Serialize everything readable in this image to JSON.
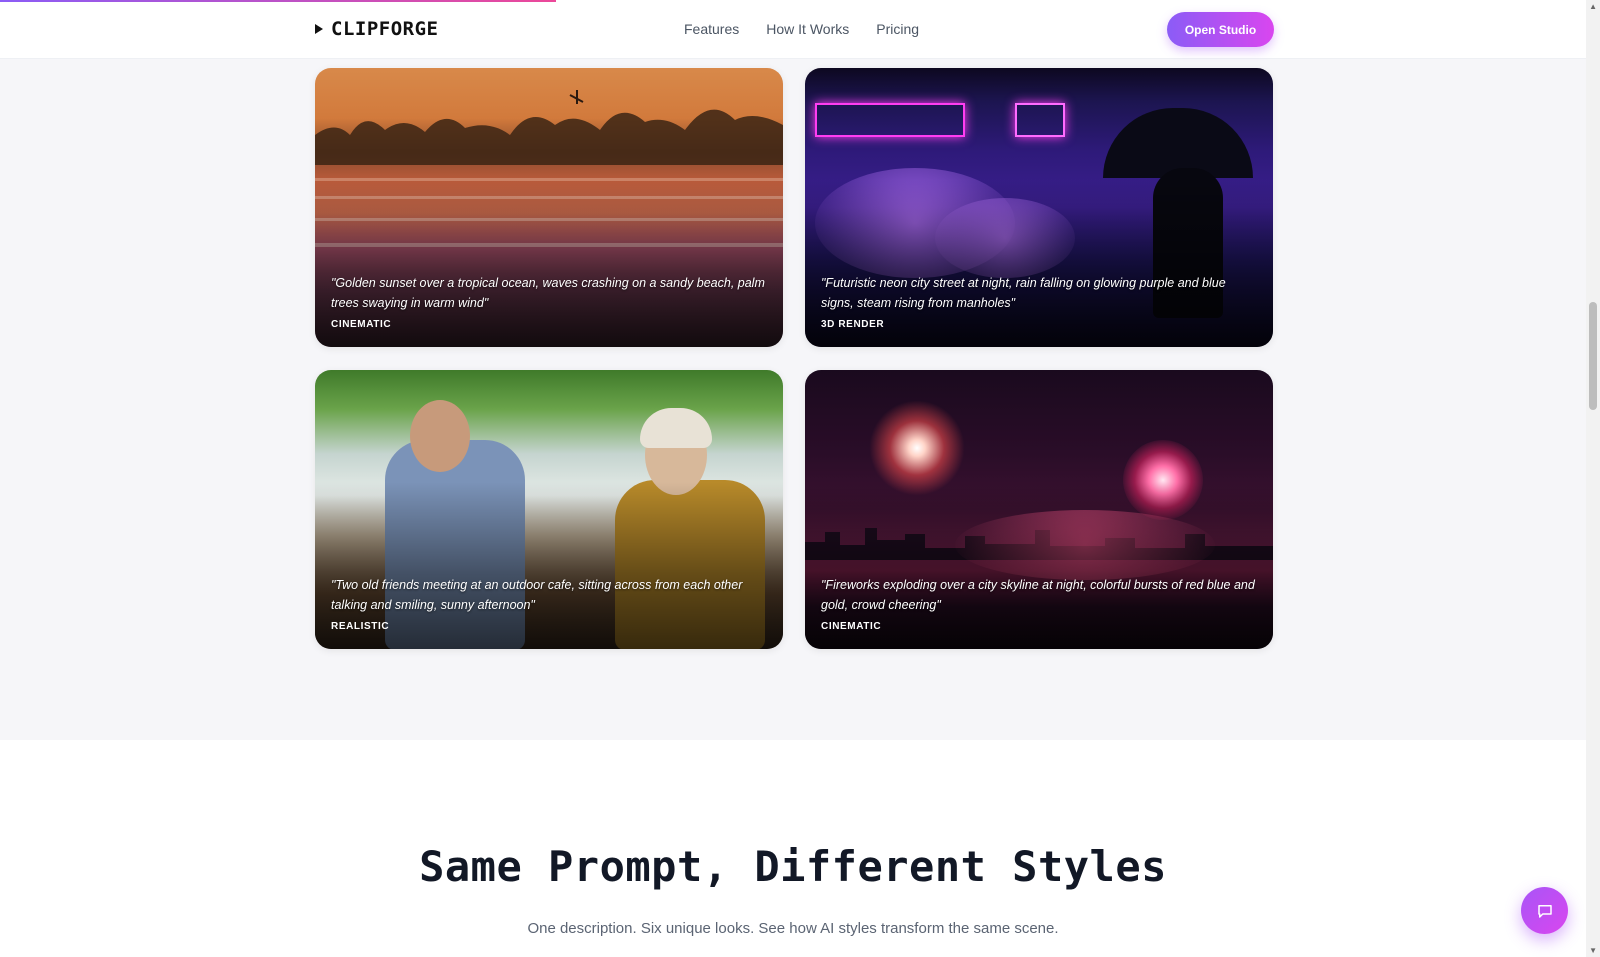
{
  "brand": {
    "name": "CLIPFORGE"
  },
  "nav": {
    "links": [
      {
        "label": "Features"
      },
      {
        "label": "How It Works"
      },
      {
        "label": "Pricing"
      }
    ],
    "cta_label": "Open Studio"
  },
  "gallery": [
    {
      "prompt": "\"Golden sunset over a tropical ocean, waves crashing on a sandy beach, palm trees swaying in warm wind\"",
      "tag": "CINEMATIC"
    },
    {
      "prompt": "\"Futuristic neon city street at night, rain falling on glowing purple and blue signs, steam rising from manholes\"",
      "tag": "3D RENDER"
    },
    {
      "prompt": "\"Two old friends meeting at an outdoor cafe, sitting across from each other talking and smiling, sunny afternoon\"",
      "tag": "REALISTIC"
    },
    {
      "prompt": "\"Fireworks exploding over a city skyline at night, colorful bursts of red blue and gold, crowd cheering\"",
      "tag": "CINEMATIC"
    }
  ],
  "styles_section": {
    "title": "Same Prompt, Different Styles",
    "subtitle": "One description. Six unique looks. See how AI styles transform the same scene."
  },
  "colors": {
    "accent_start": "#8b5cf6",
    "accent_end": "#d946ef",
    "heading": "#121826"
  },
  "icons": {
    "logo": "play-triangle-icon",
    "chat": "chat-bubble-icon"
  }
}
